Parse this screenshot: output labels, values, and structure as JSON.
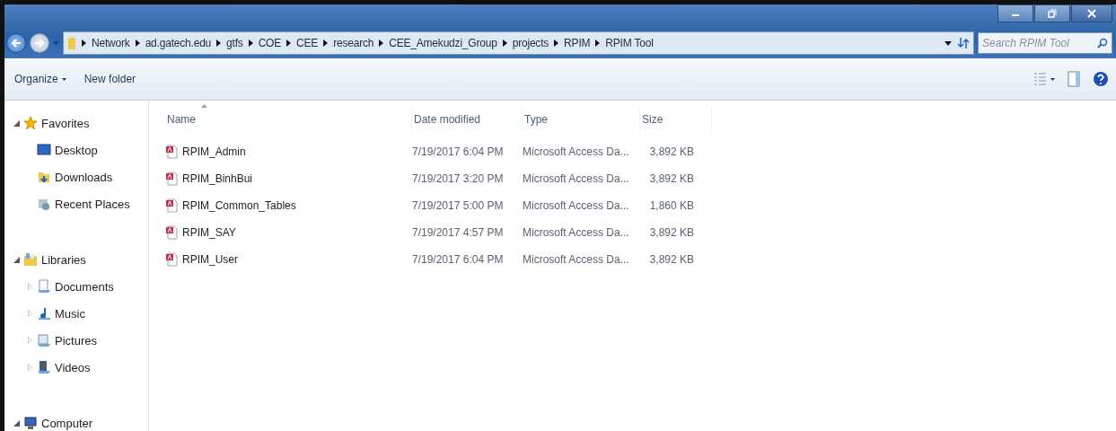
{
  "address_bar": {
    "path": [
      "Network",
      "ad.gatech.edu",
      "gtfs",
      "COE",
      "CEE",
      "research",
      "CEE_Amekudzi_Group",
      "projects",
      "RPIM",
      "RPIM Tool"
    ]
  },
  "search": {
    "placeholder": "Search RPIM Tool"
  },
  "toolbar": {
    "buttons": [
      {
        "label": "Organize",
        "dropdown": true
      },
      {
        "label": "New folder",
        "dropdown": false
      }
    ]
  },
  "sidebar": {
    "groups": [
      {
        "label": "Favorites",
        "expanded": true,
        "children": [
          {
            "label": "Desktop",
            "expandable": false
          },
          {
            "label": "Downloads",
            "expandable": false
          },
          {
            "label": "Recent Places",
            "expandable": false
          }
        ]
      },
      {
        "label": "Libraries",
        "expanded": true,
        "children": [
          {
            "label": "Documents",
            "expandable": true
          },
          {
            "label": "Music",
            "expandable": true
          },
          {
            "label": "Pictures",
            "expandable": true
          },
          {
            "label": "Videos",
            "expandable": true
          }
        ]
      },
      {
        "label": "Computer",
        "expanded": true
      }
    ]
  },
  "table": {
    "columns": [
      {
        "label": "Name",
        "sorted": true
      },
      {
        "label": "Date modified",
        "sorted": false
      },
      {
        "label": "Type",
        "sorted": false
      },
      {
        "label": "Size",
        "sorted": false
      }
    ],
    "rows": [
      {
        "name": "RPIM_Admin",
        "date": "7/19/2017 6:04 PM",
        "type": "Microsoft Access Da...",
        "size": "3,892 KB"
      },
      {
        "name": "RPIM_BinhBui",
        "date": "7/19/2017 3:20 PM",
        "type": "Microsoft Access Da...",
        "size": "3,892 KB"
      },
      {
        "name": "RPIM_Common_Tables",
        "date": "7/19/2017 5:00 PM",
        "type": "Microsoft Access Da...",
        "size": "1,860 KB"
      },
      {
        "name": "RPIM_SAY",
        "date": "7/19/2017 4:57 PM",
        "type": "Microsoft Access Da...",
        "size": "3,892 KB"
      },
      {
        "name": "RPIM_User",
        "date": "7/19/2017 6:04 PM",
        "type": "Microsoft Access Da...",
        "size": "3,892 KB"
      }
    ]
  }
}
